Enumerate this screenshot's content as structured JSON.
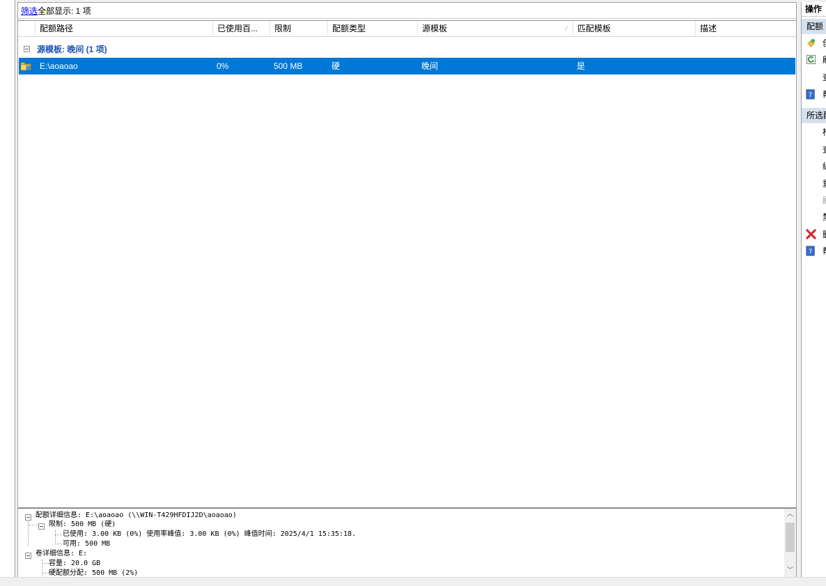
{
  "filter": {
    "link": "筛选",
    "summary": "全部显示: 1 项"
  },
  "columns": [
    {
      "label": "配额路径"
    },
    {
      "label": "已使用百..."
    },
    {
      "label": "限制"
    },
    {
      "label": "配额类型"
    },
    {
      "label": "源模板"
    },
    {
      "label": "匹配模板"
    },
    {
      "label": "描述"
    }
  ],
  "group": {
    "label": "源模板: 晚间 (1 项)"
  },
  "rows": [
    {
      "path": "E:\\aoaoao",
      "used": "0%",
      "limit": "500 MB",
      "type": "硬",
      "template": "晚间",
      "matches": "是",
      "description": ""
    }
  ],
  "details": {
    "lines": [
      "配额详细信息: E:\\aoaoao (\\\\WIN-T429HFDIJ2D\\aoaoao)",
      "限制: 500 MB (硬)",
      "已使用: 3.00 KB (0%) 使用率峰值: 3.00 KB (0%) 峰值时间: 2025/4/1 15:35:18.",
      "可用: 500 MB",
      "卷详细信息: E:",
      "容量: 20.0 GB",
      "硬配额分配: 500 MB (2%)"
    ]
  },
  "actions": {
    "title": "操作",
    "section1": "配额",
    "section1_items": [
      "创",
      "刷",
      "查",
      "帮"
    ],
    "section2": "所选配",
    "section2_items": [
      "根",
      "查",
      "编",
      "重",
      "刷",
      "禁",
      "删",
      "帮"
    ]
  },
  "colors": {
    "selection": "#0078d7",
    "group_text": "#1f54b4",
    "section_bg": "#d6e1ee"
  }
}
